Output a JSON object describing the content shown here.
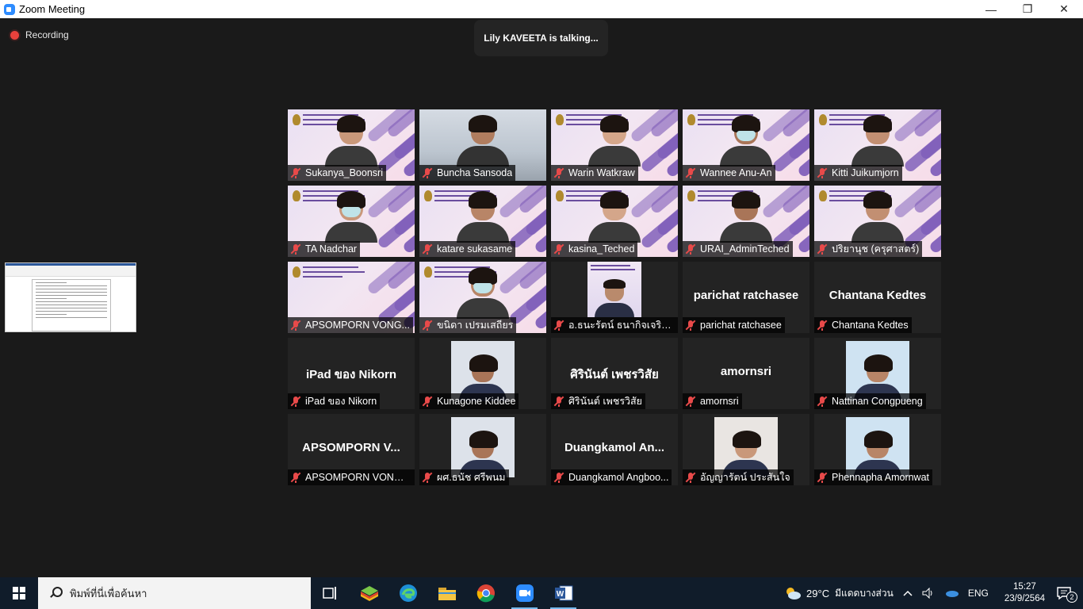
{
  "window": {
    "title": "Zoom Meeting"
  },
  "controls": {
    "minimize": "—",
    "restore": "❐",
    "close": "✕"
  },
  "recording": {
    "label": "Recording"
  },
  "talking": {
    "text": "Lily KAVEETA is talking..."
  },
  "participants": [
    {
      "name": "Sukanya_Boonsri",
      "kind": "purple"
    },
    {
      "name": "Buncha Sansoda",
      "kind": "room"
    },
    {
      "name": "Warin Watkraw",
      "kind": "purple"
    },
    {
      "name": "Wannee Anu-An",
      "kind": "purple-mask"
    },
    {
      "name": "Kitti Juikumjorn",
      "kind": "purple"
    },
    {
      "name": "TA Nadchar",
      "kind": "purple-mask"
    },
    {
      "name": "katare sukasame",
      "kind": "purple"
    },
    {
      "name": "kasina_Teched",
      "kind": "purple"
    },
    {
      "name": "URAI_AdminTeched",
      "kind": "purple"
    },
    {
      "name": "ปริยานุช (ครุศาสตร์)",
      "kind": "purple"
    },
    {
      "name": "APSOMPORN VONG...",
      "kind": "purple-empty"
    },
    {
      "name": "ขนิดา เปรมเสถียร",
      "kind": "purple-mask"
    },
    {
      "name": "อ.ธนะรัตน์ ธนากิจเจริญสุข",
      "kind": "small-video"
    },
    {
      "name": "parichat ratchasee",
      "kind": "text",
      "big": "parichat ratchasee"
    },
    {
      "name": "Chantana Kedtes",
      "kind": "text",
      "big": "Chantana Kedtes"
    },
    {
      "name": "iPad ของ Nikorn",
      "kind": "text",
      "big": "iPad ของ Nikorn"
    },
    {
      "name": "Kunagone Kiddee",
      "kind": "avatar"
    },
    {
      "name": "ศิรินันต์ เพชรวิสัย",
      "kind": "text",
      "big": "ศิรินันต์ เพชรวิสัย"
    },
    {
      "name": "amornsri",
      "kind": "text",
      "big": "amornsri"
    },
    {
      "name": "Nattinan Congpueng",
      "kind": "avatar"
    },
    {
      "name": "APSOMPORN VONGPEA...",
      "kind": "text",
      "big": "APSOMPORN  V..."
    },
    {
      "name": "ผศ.ธนัช  ศรีพนม",
      "kind": "avatar"
    },
    {
      "name": "Duangkamol Angboo...",
      "kind": "text",
      "big": "Duangkamol  An..."
    },
    {
      "name": "อัญญารัตน์ ประสันใจ",
      "kind": "avatar"
    },
    {
      "name": "Phennapha Amornwat",
      "kind": "avatar"
    }
  ],
  "taskbar": {
    "search_placeholder": "พิมพ์ที่นี่เพื่อค้นหา",
    "weather_temp": "29°C",
    "weather_text": "มีแดดบางส่วน",
    "language": "ENG",
    "time": "15:27",
    "date": "23/9/2564",
    "notifications": "2"
  },
  "colors": {
    "accent": "#2d8cff",
    "taskbar": "#101c2a",
    "stage": "#1a1a1a"
  }
}
